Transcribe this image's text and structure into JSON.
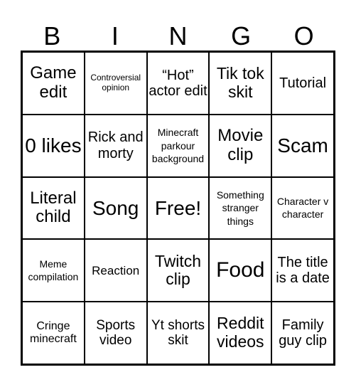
{
  "header": {
    "letters": [
      "B",
      "I",
      "N",
      "G",
      "O"
    ]
  },
  "cells": [
    [
      "Game edit",
      "Controversial opinion",
      "“Hot” actor edit",
      "Tik tok skit",
      "Tutorial"
    ],
    [
      "0 likes",
      "Rick and morty",
      "Minecraft parkour background",
      "Movie clip",
      "Scam"
    ],
    [
      "Literal child",
      "Song",
      "Free!",
      "Something stranger things",
      "Character v character"
    ],
    [
      "Meme compilation",
      "Reaction",
      "Twitch clip",
      "Food",
      "The title is a date"
    ],
    [
      "Cringe minecraft",
      "Sports video",
      "Yt shorts skit",
      "Reddit videos",
      "Family guy clip"
    ]
  ]
}
